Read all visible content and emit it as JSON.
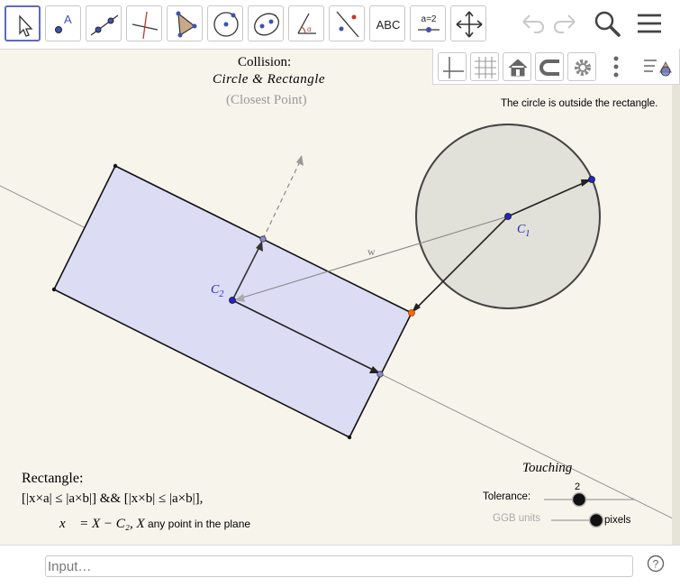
{
  "toolbar": {
    "tools": [
      {
        "name": "move-tool",
        "icon": "arrow-icon"
      },
      {
        "name": "point-tool",
        "icon": "point-icon"
      },
      {
        "name": "line-tool",
        "icon": "line-icon"
      },
      {
        "name": "perpendicular-tool",
        "icon": "perpendicular-icon"
      },
      {
        "name": "polygon-tool",
        "icon": "polygon-icon"
      },
      {
        "name": "circle-tool",
        "icon": "circle-icon"
      },
      {
        "name": "ellipse-tool",
        "icon": "ellipse-icon"
      },
      {
        "name": "angle-tool",
        "icon": "angle-icon"
      },
      {
        "name": "reflect-tool",
        "icon": "reflect-icon"
      },
      {
        "name": "text-tool",
        "icon": "text-icon"
      },
      {
        "name": "slider-tool",
        "icon": "slider-icon"
      },
      {
        "name": "move-graphics-tool",
        "icon": "move-graphics-icon"
      }
    ],
    "text_tool_label": "ABC",
    "slider_tool_label": "a=2",
    "accent_color": "#5c6bc0"
  },
  "stylebar": {
    "buttons": [
      "axes-icon",
      "grid-icon",
      "home-icon",
      "magnet-icon",
      "gear-icon",
      "more-icon",
      "view-toggle-icon"
    ]
  },
  "canvas": {
    "title_line1": "Collision:",
    "title_line2": "Circle & Rectangle",
    "title_line3": "(Closest Point)",
    "status_text": "The circle  is outside the rectangle.",
    "label_c1": "C",
    "label_c1_sub": "1",
    "label_c2": "C",
    "label_c2_sub": "2",
    "label_w": "w",
    "rectangle_title": "Rectangle:",
    "rectangle_formula": "[|x×a| ≤ |a×b|] && [|x×b| ≤ |a×b|],",
    "vector_formula": "x⃗ = X − C₂,    X",
    "vector_note": " any point in the plane",
    "touching_label": "Touching",
    "tolerance_label": "Tolerance:",
    "tolerance_value": "2",
    "units_label": "GGB units",
    "pixels_label": "pixels",
    "colors": {
      "rect_fill": "#dcdcf5",
      "circle_fill": "#dddcd6",
      "point": "#2424c8",
      "closest_point": "#ff6a00"
    }
  },
  "input": {
    "placeholder": "Input…"
  }
}
